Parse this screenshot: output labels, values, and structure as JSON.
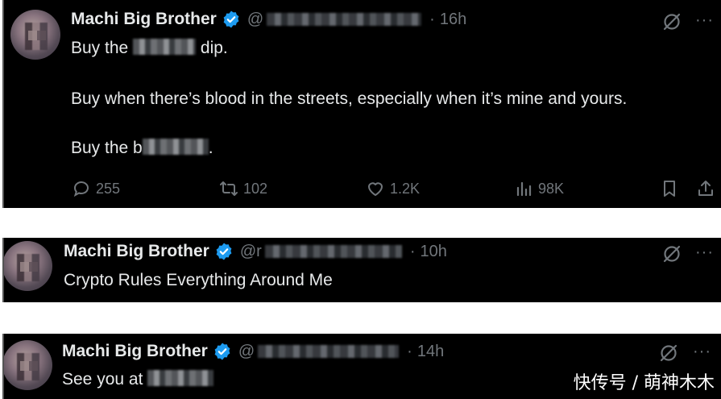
{
  "tweets": [
    {
      "name": "Machi Big Brother",
      "handle": "@",
      "time": "16h",
      "lines": [
        "Buy the",
        "dip.",
        "Buy when there’s blood in the streets, especially when it’s mine and yours.",
        "Buy the b",
        "."
      ],
      "actions": {
        "replies": "255",
        "reposts": "102",
        "likes": "1.2K",
        "views": "98K"
      }
    },
    {
      "name": "Machi Big Brother",
      "handle": "@r",
      "time": "10h",
      "lines": [
        "Crypto Rules Everything Around Me"
      ]
    },
    {
      "name": "Machi Big Brother",
      "handle": "@",
      "time": "14h",
      "lines": [
        "See you at"
      ]
    }
  ],
  "separator": "·",
  "more_label": "···",
  "watermark": "快传号 / 萌神木木",
  "colors": {
    "background": "#000000",
    "text": "#e7e9ea",
    "muted": "#71767b",
    "verified": "#1d9bf0"
  },
  "icons": [
    "verified-badge-icon",
    "grok-icon",
    "more-icon",
    "reply-icon",
    "repost-icon",
    "like-icon",
    "views-icon",
    "bookmark-icon",
    "share-icon"
  ]
}
